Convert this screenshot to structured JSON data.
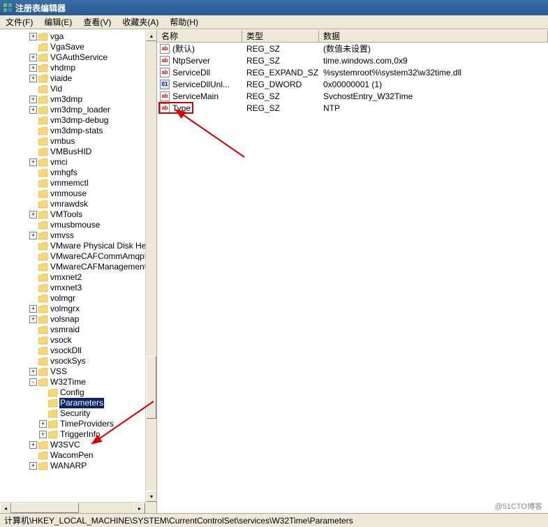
{
  "window": {
    "title": "注册表编辑器"
  },
  "menu": {
    "file": "文件(F)",
    "edit": "编辑(E)",
    "view": "查看(V)",
    "favorites": "收藏夹(A)",
    "help": "帮助(H)"
  },
  "tree_nodes": [
    {
      "indent": 3,
      "exp": "+",
      "label": "vga"
    },
    {
      "indent": 3,
      "exp": "",
      "label": "VgaSave"
    },
    {
      "indent": 3,
      "exp": "+",
      "label": "VGAuthService"
    },
    {
      "indent": 3,
      "exp": "+",
      "label": "vhdmp"
    },
    {
      "indent": 3,
      "exp": "+",
      "label": "viaide"
    },
    {
      "indent": 3,
      "exp": "",
      "label": "Vid"
    },
    {
      "indent": 3,
      "exp": "+",
      "label": "vm3dmp"
    },
    {
      "indent": 3,
      "exp": "+",
      "label": "vm3dmp_loader"
    },
    {
      "indent": 3,
      "exp": "",
      "label": "vm3dmp-debug"
    },
    {
      "indent": 3,
      "exp": "",
      "label": "vm3dmp-stats"
    },
    {
      "indent": 3,
      "exp": "",
      "label": "vmbus"
    },
    {
      "indent": 3,
      "exp": "",
      "label": "VMBusHID"
    },
    {
      "indent": 3,
      "exp": "+",
      "label": "vmci"
    },
    {
      "indent": 3,
      "exp": "",
      "label": "vmhgfs"
    },
    {
      "indent": 3,
      "exp": "",
      "label": "vmmemctl"
    },
    {
      "indent": 3,
      "exp": "",
      "label": "vmmouse"
    },
    {
      "indent": 3,
      "exp": "",
      "label": "vmrawdsk"
    },
    {
      "indent": 3,
      "exp": "+",
      "label": "VMTools"
    },
    {
      "indent": 3,
      "exp": "",
      "label": "vmusbmouse"
    },
    {
      "indent": 3,
      "exp": "+",
      "label": "vmvss"
    },
    {
      "indent": 3,
      "exp": "",
      "label": "VMware Physical Disk Hel"
    },
    {
      "indent": 3,
      "exp": "",
      "label": "VMwareCAFCommAmqpListene"
    },
    {
      "indent": 3,
      "exp": "",
      "label": "VMwareCAFManagementAgent"
    },
    {
      "indent": 3,
      "exp": "",
      "label": "vmxnet2"
    },
    {
      "indent": 3,
      "exp": "",
      "label": "vmxnet3"
    },
    {
      "indent": 3,
      "exp": "",
      "label": "volmgr"
    },
    {
      "indent": 3,
      "exp": "+",
      "label": "volmgrx"
    },
    {
      "indent": 3,
      "exp": "+",
      "label": "volsnap"
    },
    {
      "indent": 3,
      "exp": "",
      "label": "vsmraid"
    },
    {
      "indent": 3,
      "exp": "",
      "label": "vsock"
    },
    {
      "indent": 3,
      "exp": "",
      "label": "vsockDll"
    },
    {
      "indent": 3,
      "exp": "",
      "label": "vsockSys"
    },
    {
      "indent": 3,
      "exp": "+",
      "label": "VSS"
    },
    {
      "indent": 3,
      "exp": "-",
      "label": "W32Time"
    },
    {
      "indent": 4,
      "exp": "",
      "label": "Config"
    },
    {
      "indent": 4,
      "exp": "",
      "label": "Parameters",
      "selected": true
    },
    {
      "indent": 4,
      "exp": "",
      "label": "Security"
    },
    {
      "indent": 4,
      "exp": "+",
      "label": "TimeProviders"
    },
    {
      "indent": 4,
      "exp": "+",
      "label": "TriggerInfo"
    },
    {
      "indent": 3,
      "exp": "+",
      "label": "W3SVC"
    },
    {
      "indent": 3,
      "exp": "",
      "label": "WacomPen"
    },
    {
      "indent": 3,
      "exp": "+",
      "label": "WANARP"
    }
  ],
  "list_header": {
    "name": "名称",
    "type": "类型",
    "data": "数据"
  },
  "list_rows": [
    {
      "icon": "ab",
      "name": "(默认)",
      "type": "REG_SZ",
      "data": "(数值未设置)"
    },
    {
      "icon": "ab",
      "name": "NtpServer",
      "type": "REG_SZ",
      "data": "time.windows.com,0x9"
    },
    {
      "icon": "ab",
      "name": "ServiceDll",
      "type": "REG_EXPAND_SZ",
      "data": "%systemroot%\\system32\\w32time.dll"
    },
    {
      "icon": "bin",
      "name": "ServiceDllUnl...",
      "type": "REG_DWORD",
      "data": "0x00000001 (1)"
    },
    {
      "icon": "ab",
      "name": "ServiceMain",
      "type": "REG_SZ",
      "data": "SvchostEntry_W32Time"
    },
    {
      "icon": "ab",
      "name": "Type",
      "type": "REG_SZ",
      "data": "NTP"
    }
  ],
  "statusbar": {
    "path": "计算机\\HKEY_LOCAL_MACHINE\\SYSTEM\\CurrentControlSet\\services\\W32Time\\Parameters"
  },
  "watermark": "@51CTO博客"
}
